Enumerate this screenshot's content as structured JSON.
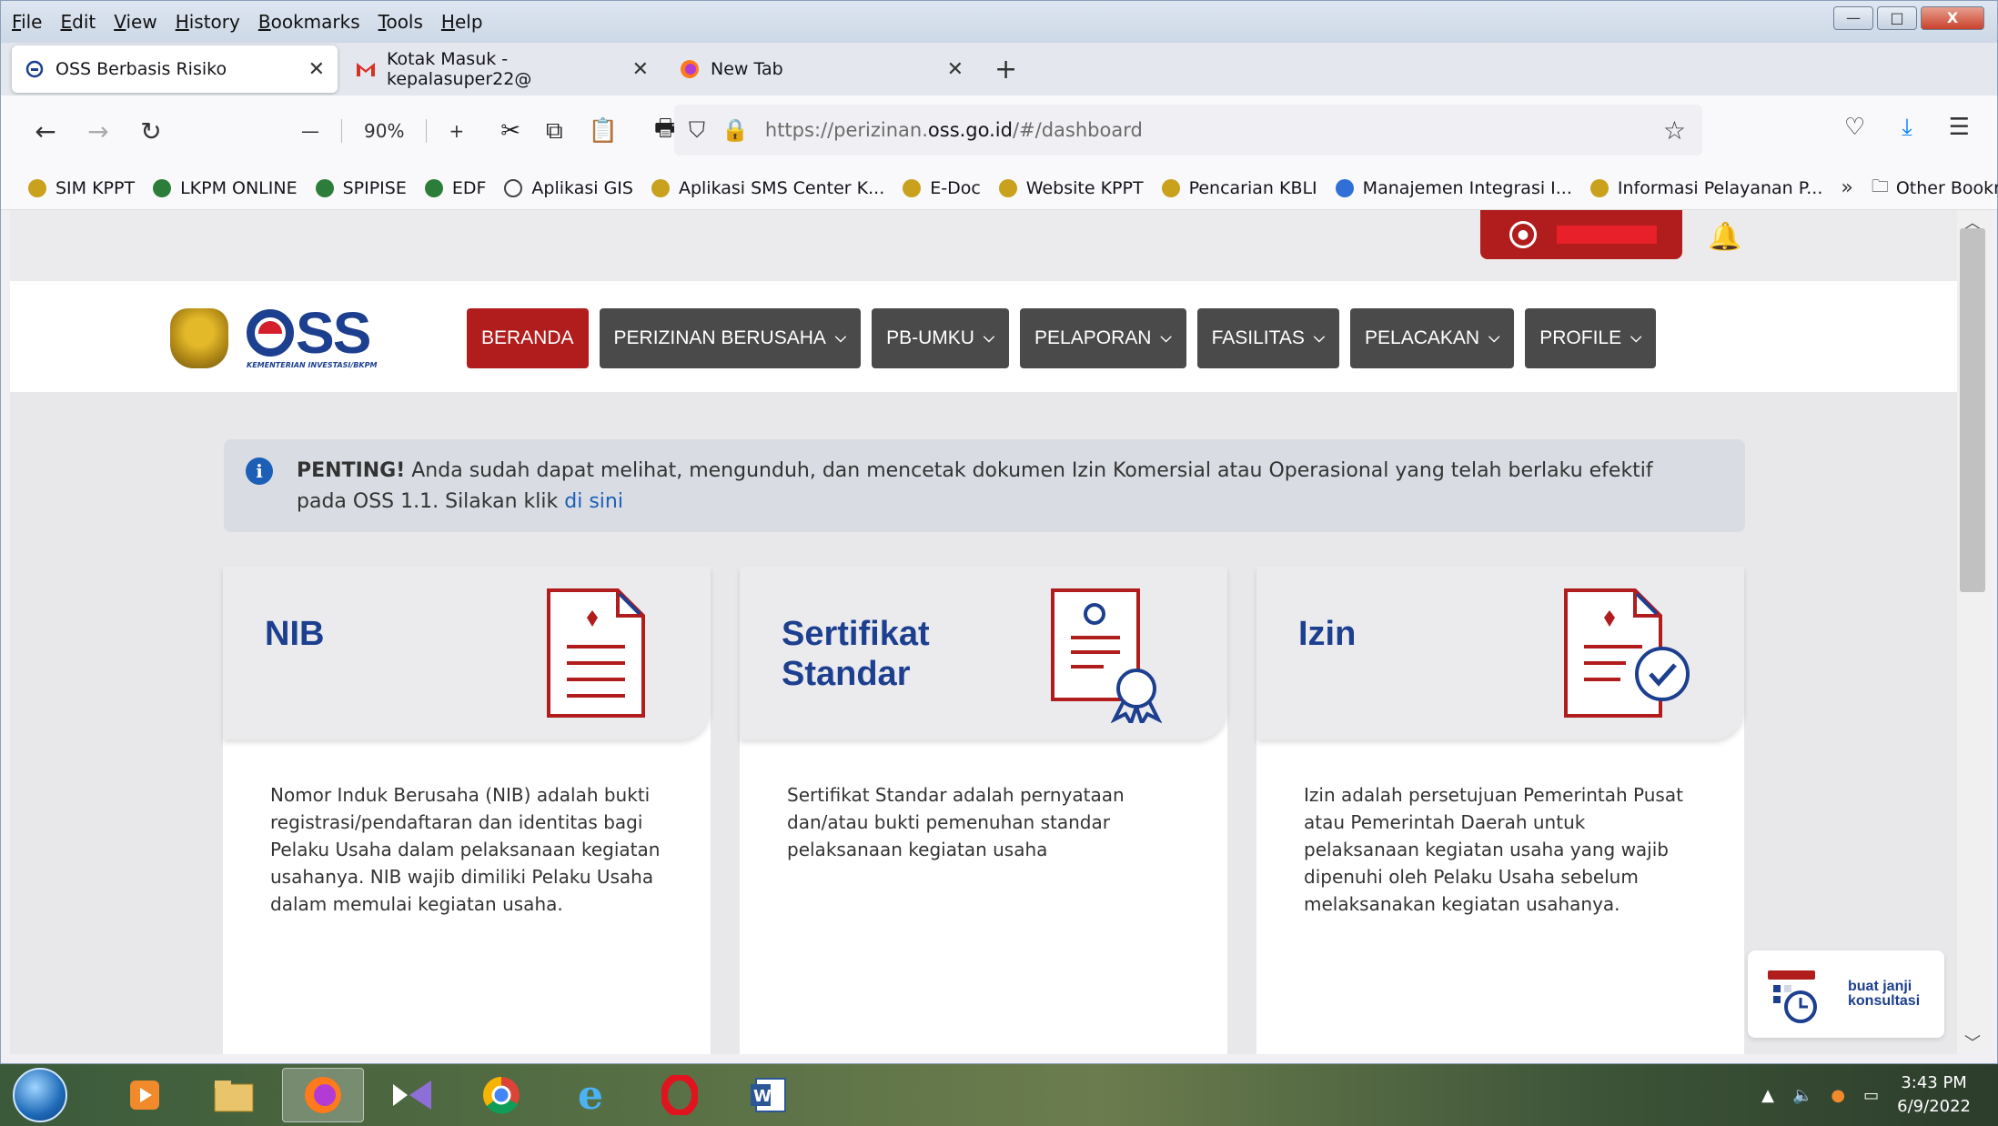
{
  "menubar": {
    "items": [
      "File",
      "Edit",
      "View",
      "History",
      "Bookmarks",
      "Tools",
      "Help"
    ]
  },
  "window_controls": {
    "minimize": "—",
    "maximize": "□",
    "close": "X"
  },
  "tabs": [
    {
      "title": "OSS Berbasis Risiko",
      "active": true,
      "icon": "oss-favicon"
    },
    {
      "title": "Kotak Masuk - kepalasuper22@",
      "active": false,
      "icon": "gmail-icon"
    },
    {
      "title": "New Tab",
      "active": false,
      "icon": "firefox-icon"
    }
  ],
  "toolbar": {
    "zoom": "90%",
    "zoom_minus": "—",
    "zoom_plus": "+"
  },
  "urlbar": {
    "prefix": "https://perizinan.",
    "domain": "oss.go.id",
    "suffix": "/#/dashboard"
  },
  "bookmarks": [
    "SIM KPPT",
    "LKPM ONLINE",
    "SPIPISE",
    "EDF",
    "Aplikasi GIS",
    "Aplikasi SMS Center K...",
    "E-Doc",
    "Website KPPT",
    "Pencarian KBLI",
    "Manajemen Integrasi I...",
    "Informasi Pelayanan P..."
  ],
  "bookmarks_other": "Other Bookmarks",
  "brand": {
    "name": "OSS",
    "subtitle": "KEMENTERIAN INVESTASI/BKPM"
  },
  "nav": [
    {
      "label": "BERANDA",
      "active": true,
      "dropdown": false
    },
    {
      "label": "PERIZINAN BERUSAHA",
      "active": false,
      "dropdown": true
    },
    {
      "label": "PB-UMKU",
      "active": false,
      "dropdown": true
    },
    {
      "label": "PELAPORAN",
      "active": false,
      "dropdown": true
    },
    {
      "label": "FASILITAS",
      "active": false,
      "dropdown": true
    },
    {
      "label": "PELACAKAN",
      "active": false,
      "dropdown": true
    },
    {
      "label": "PROFILE",
      "active": false,
      "dropdown": true
    }
  ],
  "notice": {
    "strong": "PENTING!",
    "text": " Anda sudah dapat melihat, mengunduh, dan mencetak dokumen Izin Komersial atau Operasional yang telah berlaku efektif pada OSS 1.1. Silakan klik ",
    "link": "di sini"
  },
  "cards": [
    {
      "title": "NIB",
      "text": "Nomor Induk Berusaha (NIB) adalah bukti registrasi/pendaftaran dan identitas bagi Pelaku Usaha dalam pelaksanaan kegiatan usahanya. NIB wajib dimiliki Pelaku Usaha dalam memulai kegiatan usaha."
    },
    {
      "title": "Sertifikat\nStandar",
      "text": "Sertifikat Standar adalah pernyataan dan/atau bukti pemenuhan standar pelaksanaan kegiatan usaha"
    },
    {
      "title": "Izin",
      "text": "Izin adalah persetujuan Pemerintah Pusat atau Pemerintah Daerah untuk pelaksanaan kegiatan usaha yang wajib dipenuhi oleh Pelaku Usaha sebelum melaksanakan kegiatan usahanya."
    }
  ],
  "consult": {
    "line1": "buat janji",
    "line2": "konsultasi"
  },
  "colors": {
    "brand_blue": "#1d3f8f",
    "brand_red": "#b11c1c",
    "nav_dark": "#4a4a4a"
  },
  "taskbar": {
    "apps": [
      "media-player-icon",
      "file-explorer-icon",
      "firefox-icon",
      "visual-studio-icon",
      "chrome-icon",
      "internet-explorer-icon",
      "opera-icon",
      "word-icon"
    ],
    "time": "3:43 PM",
    "date": "6/9/2022"
  }
}
